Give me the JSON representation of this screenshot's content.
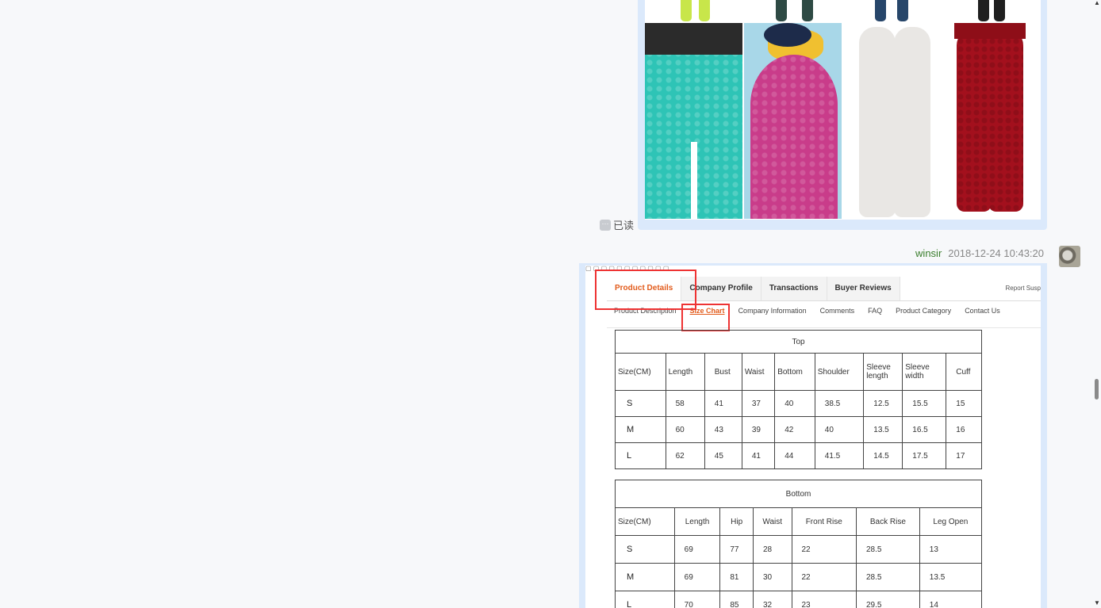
{
  "message1": {
    "read_label": "已读"
  },
  "message2": {
    "sender": "winsir",
    "timestamp": "2018-12-24 10:43:20"
  },
  "product_page": {
    "tabs": [
      "Product Details",
      "Company Profile",
      "Transactions",
      "Buyer Reviews"
    ],
    "report_label": "Report Susp",
    "subtabs": [
      "Product Description",
      "Size Chart",
      "Company Information",
      "Comments",
      "FAQ",
      "Product Category",
      "Contact Us"
    ],
    "top_table": {
      "title": "Top",
      "headers": [
        "Size(CM)",
        "Length",
        "Bust",
        "Waist",
        "Bottom",
        "Shoulder",
        "Sleeve length",
        "Sleeve width",
        "Cuff"
      ],
      "rows": [
        [
          "S",
          "58",
          "41",
          "37",
          "40",
          "38.5",
          "12.5",
          "15.5",
          "15"
        ],
        [
          "M",
          "60",
          "43",
          "39",
          "42",
          "40",
          "13.5",
          "16.5",
          "16"
        ],
        [
          "L",
          "62",
          "45",
          "41",
          "44",
          "41.5",
          "14.5",
          "17.5",
          "17"
        ]
      ]
    },
    "bottom_table": {
      "title": "Bottom",
      "headers": [
        "Size(CM)",
        "Length",
        "Hip",
        "Waist",
        "Front Rise",
        "Back Rise",
        "Leg Open"
      ],
      "rows": [
        [
          "S",
          "69",
          "77",
          "28",
          "22",
          "28.5",
          "13"
        ],
        [
          "M",
          "69",
          "81",
          "30",
          "22",
          "28.5",
          "13.5"
        ],
        [
          "L",
          "70",
          "85",
          "32",
          "23",
          "29.5",
          "14"
        ]
      ]
    }
  },
  "colors": {
    "accent": "#e25c1c",
    "highlight_box": "#ee3333",
    "bubble": "#dbe9fb",
    "sender": "#3a7d2c"
  }
}
